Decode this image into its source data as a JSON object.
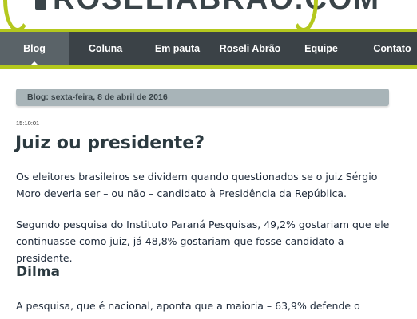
{
  "header": {
    "logo_text": "ROSELIABRAO.COM",
    "accent_color": "#b4c81e",
    "nav_bg": "#3b4247"
  },
  "nav": {
    "items": [
      {
        "label": "Blog"
      },
      {
        "label": "Coluna"
      },
      {
        "label": "Em pauta"
      },
      {
        "label": "Roseli Abrão"
      },
      {
        "label": "Equipe"
      },
      {
        "label": "Contato"
      }
    ],
    "active": "Blog"
  },
  "breadcrumb": "Blog: sexta-feira, 8 de abril de 2016",
  "post": {
    "time": "15:10:01",
    "title": "Juiz ou presidente?",
    "paragraphs": [
      "Os eleitores brasileiros se dividem quando questionados se o juiz Sérgio Moro deveria ser – ou não – candidato à Presidência da República.",
      "Segundo pesquisa do Instituto Paraná Pesquisas, 49,2% gostariam que ele continuasse como juiz, já 48,8% gostariam que fosse candidato a presidente."
    ],
    "subheading": "Dilma",
    "paragraph_after_subheading": "A pesquisa, que é nacional, aponta que a maioria – 63,9% defende o"
  }
}
